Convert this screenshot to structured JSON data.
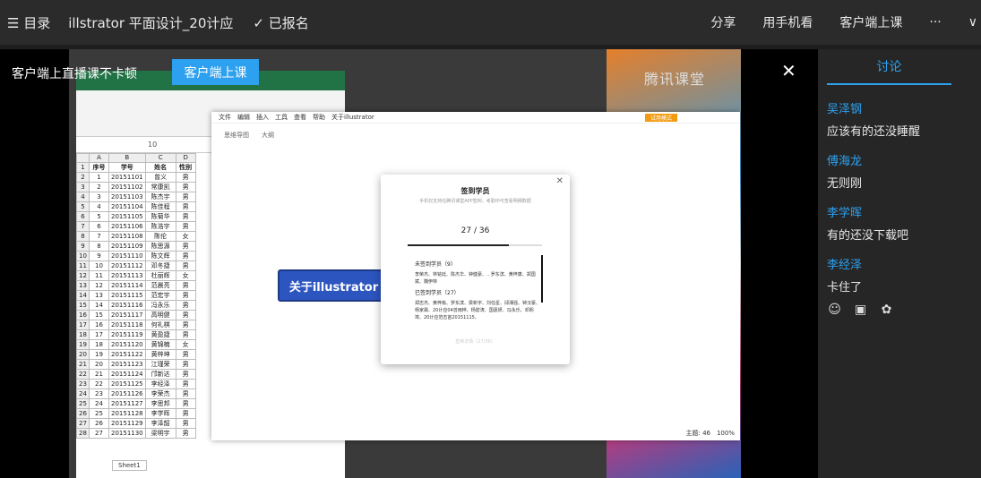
{
  "header": {
    "menu_icon": "hamburger-icon",
    "menu_label": "☰ 目录",
    "course_title": "illstrator 平面设计_20计应",
    "registered": "✓ 已报名",
    "share": "分享",
    "phone_watch": "用手机看",
    "client_class": "客户端上课",
    "more": "···",
    "expand": "∨"
  },
  "overlay": {
    "promo_text": "客户端上直播课不卡顿",
    "promo_button": "客户端上课",
    "close": "✕"
  },
  "video": {
    "logo_text": "腾讯课堂",
    "excel_formula_value": "10",
    "excel_col_headers": [
      "",
      "A",
      "B",
      "C",
      "D"
    ],
    "excel_header_row": [
      "1",
      "序号",
      "学号",
      "姓名",
      "性别"
    ],
    "excel_rows": [
      [
        "2",
        "1",
        "20151101",
        "曾义",
        "男"
      ],
      [
        "3",
        "2",
        "20151102",
        "常康凯",
        "男"
      ],
      [
        "4",
        "3",
        "20151103",
        "陈杰宇",
        "男"
      ],
      [
        "5",
        "4",
        "20151104",
        "陈佳程",
        "男"
      ],
      [
        "6",
        "5",
        "20151105",
        "陈菊华",
        "男"
      ],
      [
        "7",
        "6",
        "20151106",
        "陈浩宇",
        "男"
      ],
      [
        "8",
        "7",
        "20151108",
        "陈伦",
        "女"
      ],
      [
        "9",
        "8",
        "20151109",
        "陈思源",
        "男"
      ],
      [
        "10",
        "9",
        "20151110",
        "陈文辉",
        "男"
      ],
      [
        "11",
        "10",
        "20151112",
        "邓冬捷",
        "男"
      ],
      [
        "12",
        "11",
        "20151113",
        "杜丽辉",
        "女"
      ],
      [
        "13",
        "12",
        "20151114",
        "范晨亮",
        "男"
      ],
      [
        "14",
        "13",
        "20151115",
        "范宏宇",
        "男"
      ],
      [
        "15",
        "14",
        "20151116",
        "冯永乐",
        "男"
      ],
      [
        "16",
        "15",
        "20151117",
        "高明健",
        "男"
      ],
      [
        "17",
        "16",
        "20151118",
        "何礼棋",
        "男"
      ],
      [
        "18",
        "17",
        "20151119",
        "黄盈捷",
        "男"
      ],
      [
        "19",
        "18",
        "20151120",
        "黄锦楠",
        "女"
      ],
      [
        "20",
        "19",
        "20151122",
        "黄梓坤",
        "男"
      ],
      [
        "21",
        "20",
        "20151123",
        "江瑾荣",
        "男"
      ],
      [
        "22",
        "21",
        "20151124",
        "邝新达",
        "男"
      ],
      [
        "23",
        "22",
        "20151125",
        "李经泽",
        "男"
      ],
      [
        "24",
        "23",
        "20151126",
        "李荣杰",
        "男"
      ],
      [
        "25",
        "24",
        "20151127",
        "李思邦",
        "男"
      ],
      [
        "26",
        "25",
        "20151128",
        "李学晖",
        "男"
      ],
      [
        "27",
        "26",
        "20151129",
        "李泽韶",
        "男"
      ],
      [
        "28",
        "27",
        "20151130",
        "梁明宇",
        "男"
      ]
    ],
    "excel_sheet_tab": "Sheet1",
    "mind_menu": "文件　编辑　插入　工具　查看　帮助　关于illustrator",
    "mind_badge": "试用模式",
    "mind_tabs": "思维导图　　大纲",
    "mind_node": "关于illustrator",
    "mind_status": "主题: 46　100%",
    "checkin": {
      "title": "签到学员",
      "subtitle": "手机仅支持在腾讯课堂APP签到，考勤中可查看明细数据",
      "count": "27 / 36",
      "progress": 0.75,
      "unsigned_label": "未签到学员（9）",
      "unsigned_names": "李荣杰、林铭廷、陈杰华、钟健豪、.. 罗东滨、黄梓康、郑国斌、魏伊林",
      "signed_label": "已签到学员（27）",
      "signed_names": "郑志杰、黄梓栋、罗东滨、梁新宇、刘任星、邱湘强、钟汉豪、杨家霖、20计应04曾雨桦、杨碧涛、国嘉妍、冯永乐、邓熙埠、20计应范志宙20151115、",
      "footer": "签到详情（27/36）"
    }
  },
  "sidebar": {
    "tab_label": "讨论",
    "messages": [
      {
        "user": "吴泽钢",
        "text": "应该有的还没睡醒"
      },
      {
        "user": "傅海龙",
        "text": "无则刚"
      },
      {
        "user": "李学晖",
        "text": "有的还没下载吧"
      },
      {
        "user": "李经泽",
        "text": "卡住了"
      }
    ],
    "tools": [
      "smile-icon",
      "image-icon",
      "flower-icon"
    ]
  }
}
